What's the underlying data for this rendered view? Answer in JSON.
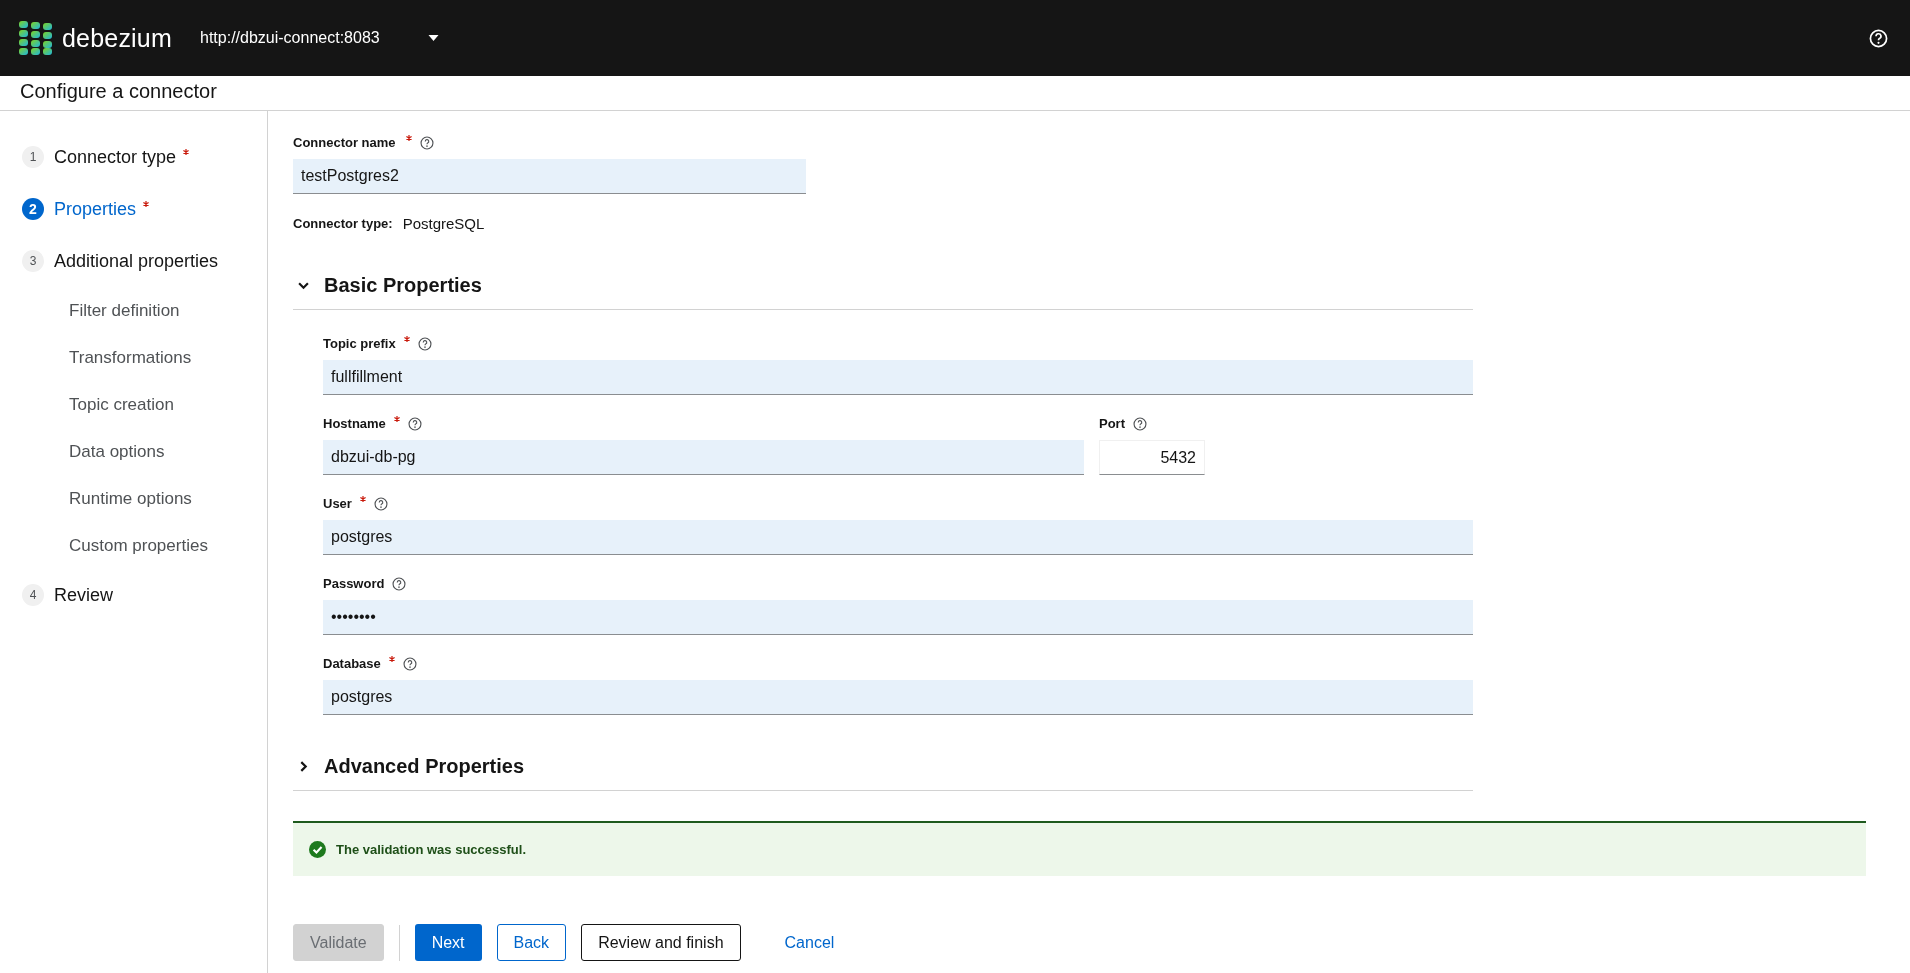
{
  "header": {
    "brand": "debezium",
    "url": "http://dbzui-connect:8083"
  },
  "page_title": "Configure a connector",
  "steps": [
    {
      "number": "1",
      "label": "Connector type",
      "required": true,
      "selected": false
    },
    {
      "number": "2",
      "label": "Properties",
      "required": true,
      "selected": true
    },
    {
      "number": "3",
      "label": "Additional properties",
      "required": false,
      "selected": false,
      "children": [
        {
          "label": "Filter definition"
        },
        {
          "label": "Transformations"
        },
        {
          "label": "Topic creation"
        },
        {
          "label": "Data options"
        },
        {
          "label": "Runtime options"
        },
        {
          "label": "Custom properties"
        }
      ]
    },
    {
      "number": "4",
      "label": "Review",
      "required": false,
      "selected": false
    }
  ],
  "connector_name": {
    "label": "Connector name",
    "required": true,
    "value": "testPostgres2"
  },
  "connector_type": {
    "label": "Connector type:",
    "value": "PostgreSQL"
  },
  "sections": [
    {
      "title": "Basic Properties",
      "expanded": true,
      "rows": [
        [
          {
            "label": "Topic prefix",
            "required": true,
            "value": "fullfillment",
            "kind": "text"
          }
        ],
        [
          {
            "label": "Hostname",
            "required": true,
            "value": "dbzui-db-pg",
            "kind": "text"
          },
          {
            "label": "Port",
            "required": false,
            "value": "5432",
            "kind": "number"
          }
        ],
        [
          {
            "label": "User",
            "required": true,
            "value": "postgres",
            "kind": "text"
          }
        ],
        [
          {
            "label": "Password",
            "required": false,
            "value": "••••••••",
            "kind": "text"
          }
        ],
        [
          {
            "label": "Database",
            "required": true,
            "value": "postgres",
            "kind": "text"
          }
        ]
      ]
    },
    {
      "title": "Advanced Properties",
      "expanded": false
    }
  ],
  "alert": {
    "kind": "success",
    "text": "The validation was successful."
  },
  "buttons": [
    {
      "label": "Validate",
      "kind": "secondary",
      "disabled": true
    },
    {
      "label": "Next",
      "kind": "primary",
      "disabled": false
    },
    {
      "label": "Back",
      "kind": "secondary",
      "disabled": false
    },
    {
      "label": "Review and finish",
      "kind": "tertiary",
      "disabled": false
    },
    {
      "label": "Cancel",
      "kind": "link",
      "disabled": false
    }
  ]
}
